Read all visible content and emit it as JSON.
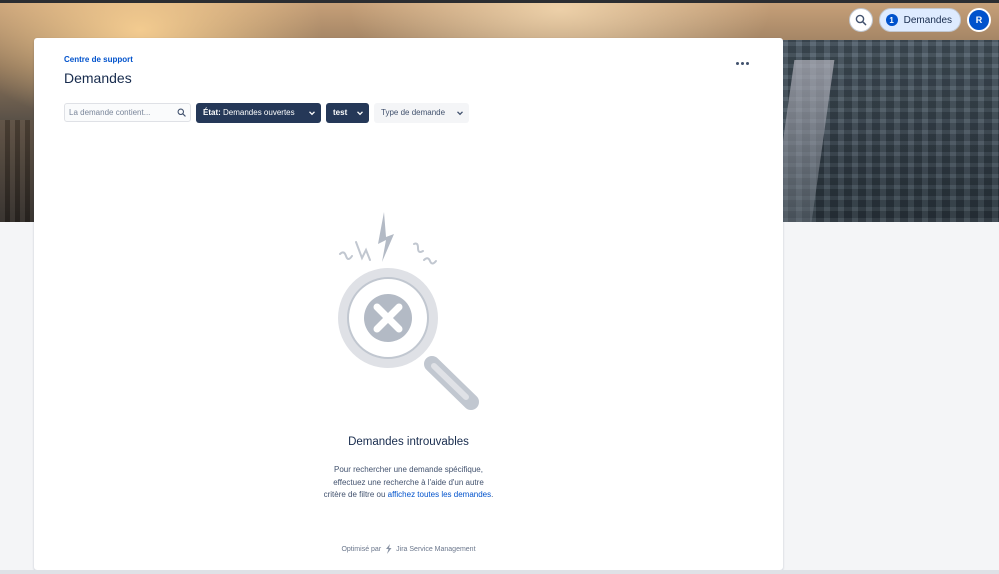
{
  "header": {
    "requests_button": {
      "count": "1",
      "label": "Demandes"
    },
    "avatar_initial": "R",
    "icons": {
      "search": "search-icon"
    }
  },
  "card": {
    "breadcrumb": "Centre de support",
    "title": "Demandes",
    "more_icon": "more-horizontal-icon"
  },
  "filters": {
    "search_placeholder": "La demande contient...",
    "status_prefix": "État:",
    "status_value": "Demandes ouvertes",
    "owner_value": "test",
    "type_label": "Type de demande"
  },
  "empty_state": {
    "title": "Demandes introuvables",
    "line1": "Pour rechercher une demande spécifique,",
    "line2": "effectuez une recherche à l'aide d'un autre",
    "line3_prefix": "critère de filtre ou",
    "link": "affichez toutes les demandes",
    "line3_suffix": "."
  },
  "footer": {
    "prefix": "Optimisé par",
    "brand": "Jira Service Management"
  },
  "colors": {
    "brand_blue": "#0052cc",
    "dark_filter": "#253858",
    "text_primary": "#172b4d"
  }
}
